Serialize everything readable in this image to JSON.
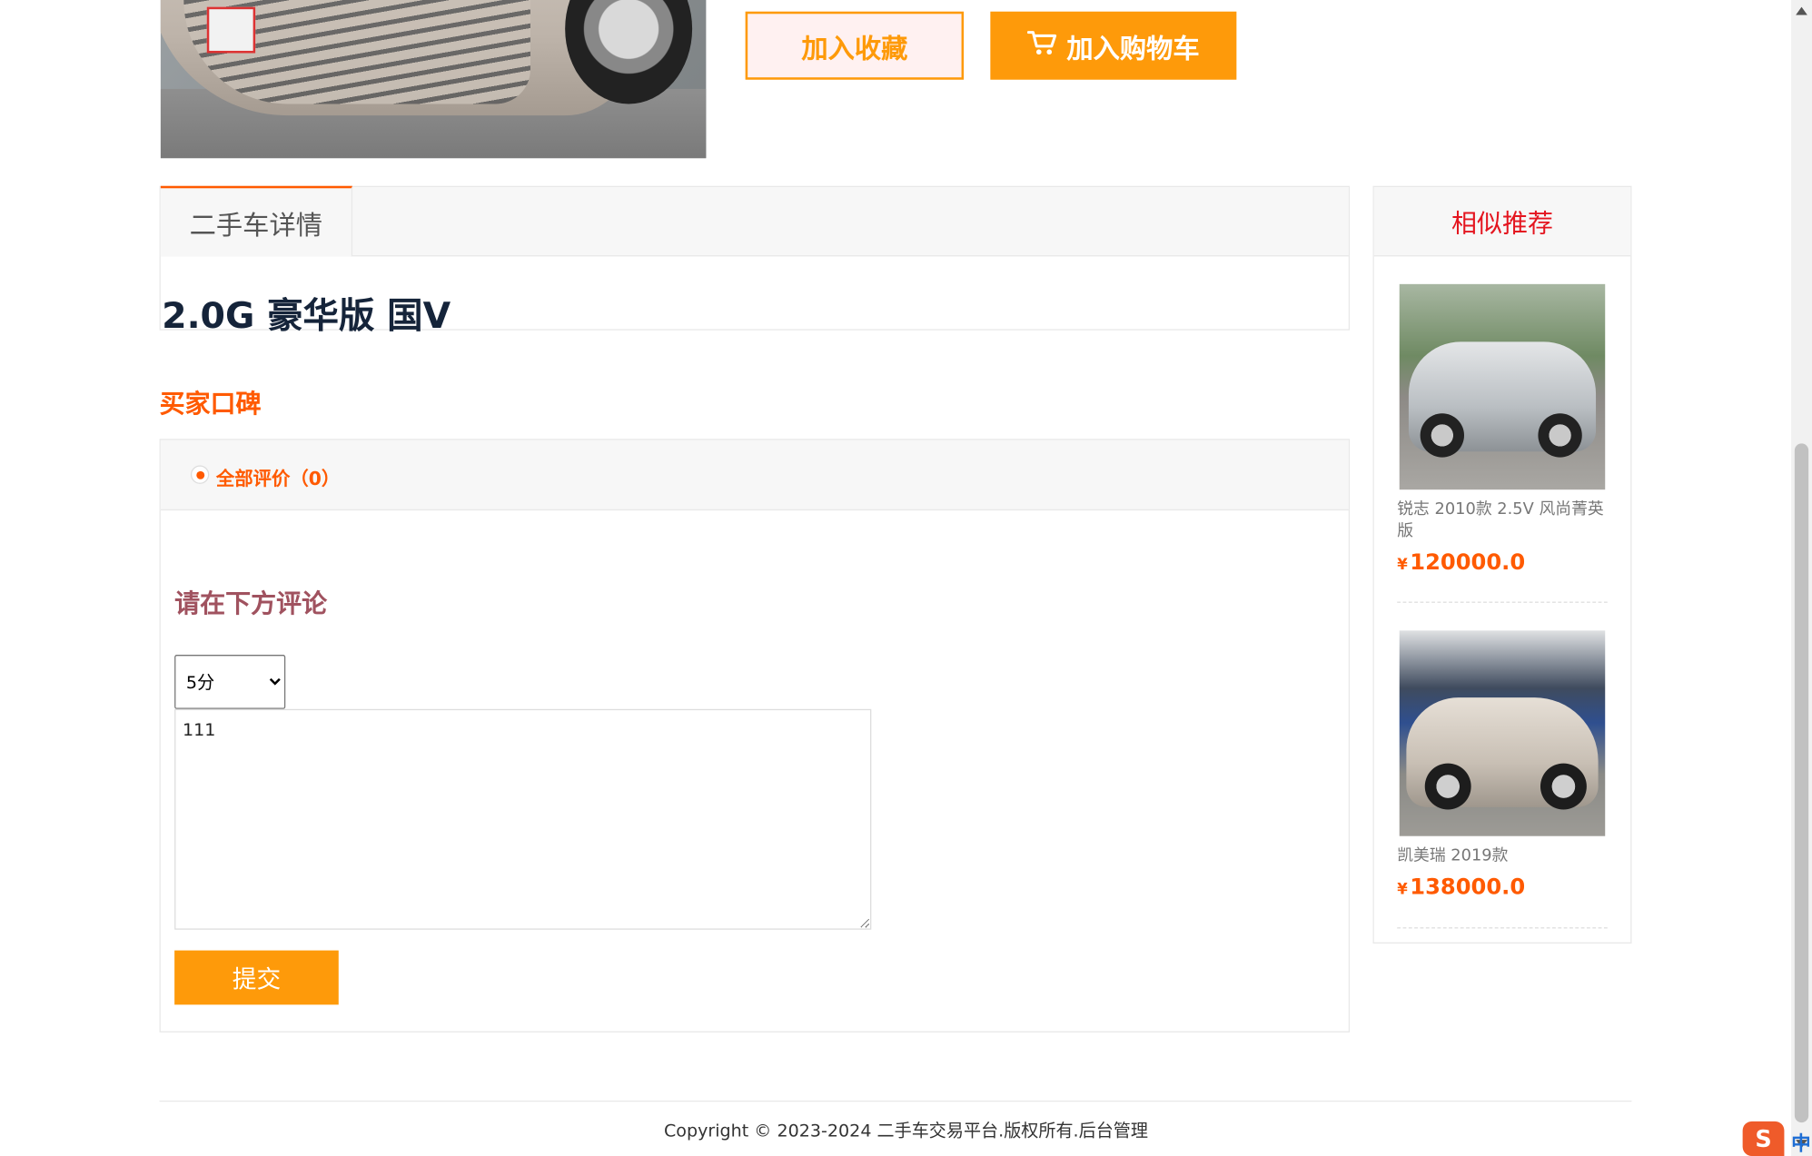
{
  "actions": {
    "favorite_label": "加入收藏",
    "cart_label": "加入购物车"
  },
  "detail": {
    "tab_label": "二手车详情",
    "car_title": "2.0G 豪华版 国V"
  },
  "reviews": {
    "section_title": "买家口碑",
    "filter_label": "全部评价（0）",
    "comment_heading": "请在下方评论",
    "score_options": [
      "5分"
    ],
    "score_selected": "5分",
    "comment_value": "111",
    "submit_label": "提交"
  },
  "sidebar": {
    "title": "相似推荐",
    "items": [
      {
        "name": "锐志 2010款 2.5V 风尚菁英版",
        "currency": "¥",
        "price": "120000.0"
      },
      {
        "name": "凯美瑞 2019款",
        "currency": "¥",
        "price": "138000.0"
      }
    ]
  },
  "footer": {
    "copyright": "Copyright © 2023-2024 二手车交易平台.版权所有.",
    "admin_link": "后台管理"
  },
  "ime": {
    "logo": "S",
    "mode": "中"
  },
  "colors": {
    "accent_orange": "#fe9a0a",
    "accent_red_orange": "#ff5a00",
    "sidebar_title_red": "#e4151f",
    "comment_heading": "#a0525f"
  }
}
